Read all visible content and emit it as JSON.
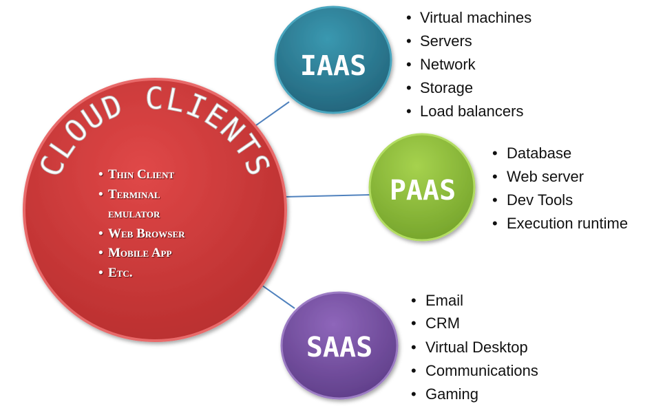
{
  "center": {
    "title": "CLOUD CLIENTS",
    "color": "#d03c3c",
    "items": [
      "Thin Client",
      "Terminal",
      "emulator",
      "Web Browser",
      "Mobile App",
      "Etc."
    ]
  },
  "nodes": [
    {
      "label": "IAAS",
      "color": "#2f7f96",
      "items": [
        "Virtual machines",
        "Servers",
        "Network",
        "Storage",
        "Load balancers"
      ]
    },
    {
      "label": "PAAS",
      "color": "#8fc13c",
      "items": [
        "Database",
        "Web server",
        "Dev Tools",
        "Execution runtime"
      ]
    },
    {
      "label": "SAAS",
      "color": "#7a52a6",
      "items": [
        "Email",
        "CRM",
        "Virtual Desktop",
        "Communications",
        "Gaming"
      ]
    }
  ],
  "connector_color": "#4f81bd"
}
